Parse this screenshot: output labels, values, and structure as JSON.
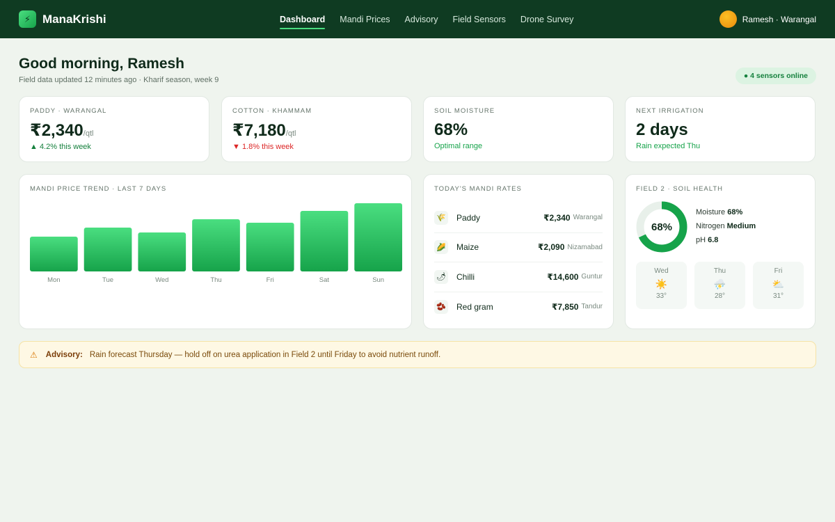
{
  "app": {
    "name": "ManaKrishi",
    "logo_glyph": "⚡"
  },
  "nav": {
    "items": [
      {
        "label": "Dashboard",
        "active": true
      },
      {
        "label": "Mandi Prices",
        "active": false
      },
      {
        "label": "Advisory",
        "active": false
      },
      {
        "label": "Field Sensors",
        "active": false
      },
      {
        "label": "Drone Survey",
        "active": false
      }
    ]
  },
  "user": {
    "name": "Ramesh · Warangal"
  },
  "greeting": {
    "title": "Good morning, Ramesh",
    "subtitle": "Field data updated 12 minutes ago · Kharif season, week 9",
    "sensors_badge": "● 4 sensors online"
  },
  "kpis": [
    {
      "label": "PADDY · WARANGAL",
      "value": "₹2,340",
      "unit": "/qtl",
      "sub": "▲ 4.2% this week",
      "trend": "up"
    },
    {
      "label": "COTTON · KHAMMAM",
      "value": "₹7,180",
      "unit": "/qtl",
      "sub": "▼ 1.8% this week",
      "trend": "down"
    },
    {
      "label": "SOIL MOISTURE",
      "value": "68%",
      "unit": "",
      "sub": "Optimal range",
      "trend": "good"
    },
    {
      "label": "NEXT IRRIGATION",
      "value": "2 days",
      "unit": "",
      "sub": "Rain expected Thu",
      "trend": "good"
    }
  ],
  "trend": {
    "title": "MANDI PRICE TREND · LAST 7 DAYS",
    "chart_data": {
      "type": "bar",
      "categories": [
        "Mon",
        "Tue",
        "Wed",
        "Thu",
        "Fri",
        "Sat",
        "Sun"
      ],
      "values": [
        50,
        63,
        56,
        75,
        70,
        87,
        98
      ],
      "ylim": [
        0,
        100
      ]
    }
  },
  "rates": {
    "title": "TODAY'S MANDI RATES",
    "items": [
      {
        "icon": "🌾",
        "crop": "Paddy",
        "price": "₹2,340",
        "market": "Warangal"
      },
      {
        "icon": "🌽",
        "crop": "Maize",
        "price": "₹2,090",
        "market": "Nizamabad"
      },
      {
        "icon": "🌶",
        "crop": "Chilli",
        "price": "₹14,600",
        "market": "Guntur"
      },
      {
        "icon": "🫘",
        "crop": "Red gram",
        "price": "₹7,850",
        "market": "Tandur"
      }
    ]
  },
  "soil": {
    "title": "FIELD 2 · SOIL HEALTH",
    "donut_label": "68%",
    "donut_fraction": 0.68,
    "moisture_label": "Moisture",
    "moisture_value": "68%",
    "nitrogen_label": "Nitrogen",
    "nitrogen_value": "Medium",
    "ph_label": "pH",
    "ph_value": "6.8",
    "forecast": [
      {
        "day": "Wed",
        "icon": "☀️",
        "temp": "33°"
      },
      {
        "day": "Thu",
        "icon": "⛈️",
        "temp": "28°"
      },
      {
        "day": "Fri",
        "icon": "⛅",
        "temp": "31°"
      }
    ]
  },
  "advisory": {
    "icon": "⚠",
    "label": "Advisory:",
    "text": "Rain forecast Thursday — hold off on urea application in Field 2 until Friday to avoid nutrient runoff."
  },
  "colors": {
    "brand_dark": "#0f3b22",
    "accent": "#22c55e",
    "bar_top": "#4ade80",
    "bar_bottom": "#16a34a"
  }
}
